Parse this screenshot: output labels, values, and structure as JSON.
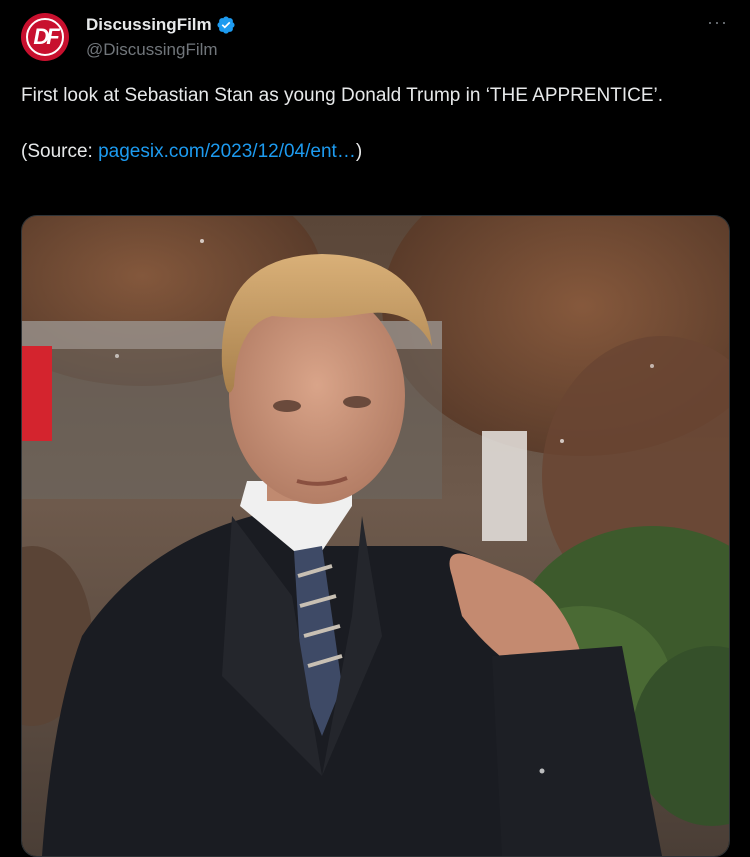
{
  "tweet": {
    "display_name": "DiscussingFilm",
    "handle": "@DiscussingFilm",
    "avatar_text": "DF",
    "more_label": "···",
    "body_line": "First look at Sebastian Stan as young Donald Trump in ‘THE APPRENTICE’.",
    "source_prefix": "(Source: ",
    "source_link": "pagesix.com/2023/12/04/ent…",
    "source_suffix": ")"
  },
  "colors": {
    "background": "#000000",
    "text": "#e7e9ea",
    "muted": "#71767b",
    "link": "#1d9bf0",
    "verified": "#1d9bf0",
    "avatar_red": "#c8102e"
  },
  "icons": {
    "verified": "verified-badge-icon",
    "more": "more-horizontal-icon"
  }
}
